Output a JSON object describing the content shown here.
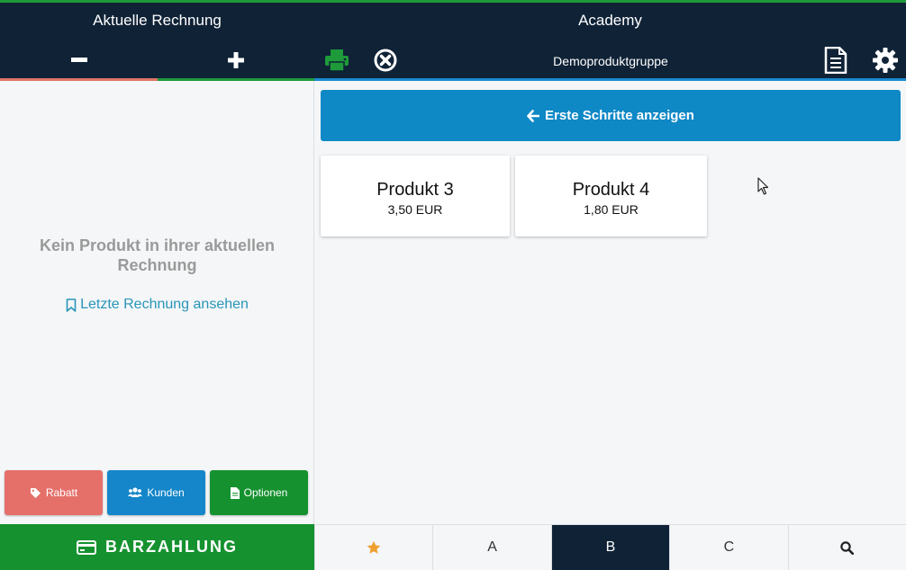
{
  "header": {
    "left_title": "Aktuelle Rechnung",
    "right_title": "Academy",
    "group_label": "Demoproduktgruppe",
    "icons": [
      "minus-icon",
      "plus-icon",
      "printer-icon",
      "cancel-circle-icon",
      "document-icon",
      "gear-icon"
    ]
  },
  "invoice": {
    "empty_message": "Kein Produkt in ihrer aktuellen Rechnung",
    "last_invoice_link": "Letzte Rechnung ansehen"
  },
  "actions": {
    "rabatt": "Rabatt",
    "kunden": "Kunden",
    "optionen": "Optionen"
  },
  "cash_button": "BARZAHLUNG",
  "first_steps_button": "Erste Schritte anzeigen",
  "products": [
    {
      "name": "Produkt 3",
      "price": "3,50 EUR"
    },
    {
      "name": "Produkt 4",
      "price": "1,80 EUR"
    }
  ],
  "tabs": [
    {
      "icon": "star-icon",
      "label": ""
    },
    {
      "label": "A"
    },
    {
      "label": "B",
      "active": true
    },
    {
      "label": "C"
    },
    {
      "icon": "search-icon",
      "label": ""
    }
  ],
  "colors": {
    "header_bg": "#0f2236",
    "green": "#15922f",
    "blue": "#0f88c6",
    "red": "#e5706a",
    "link": "#2a95b8",
    "star": "#f0a030"
  }
}
